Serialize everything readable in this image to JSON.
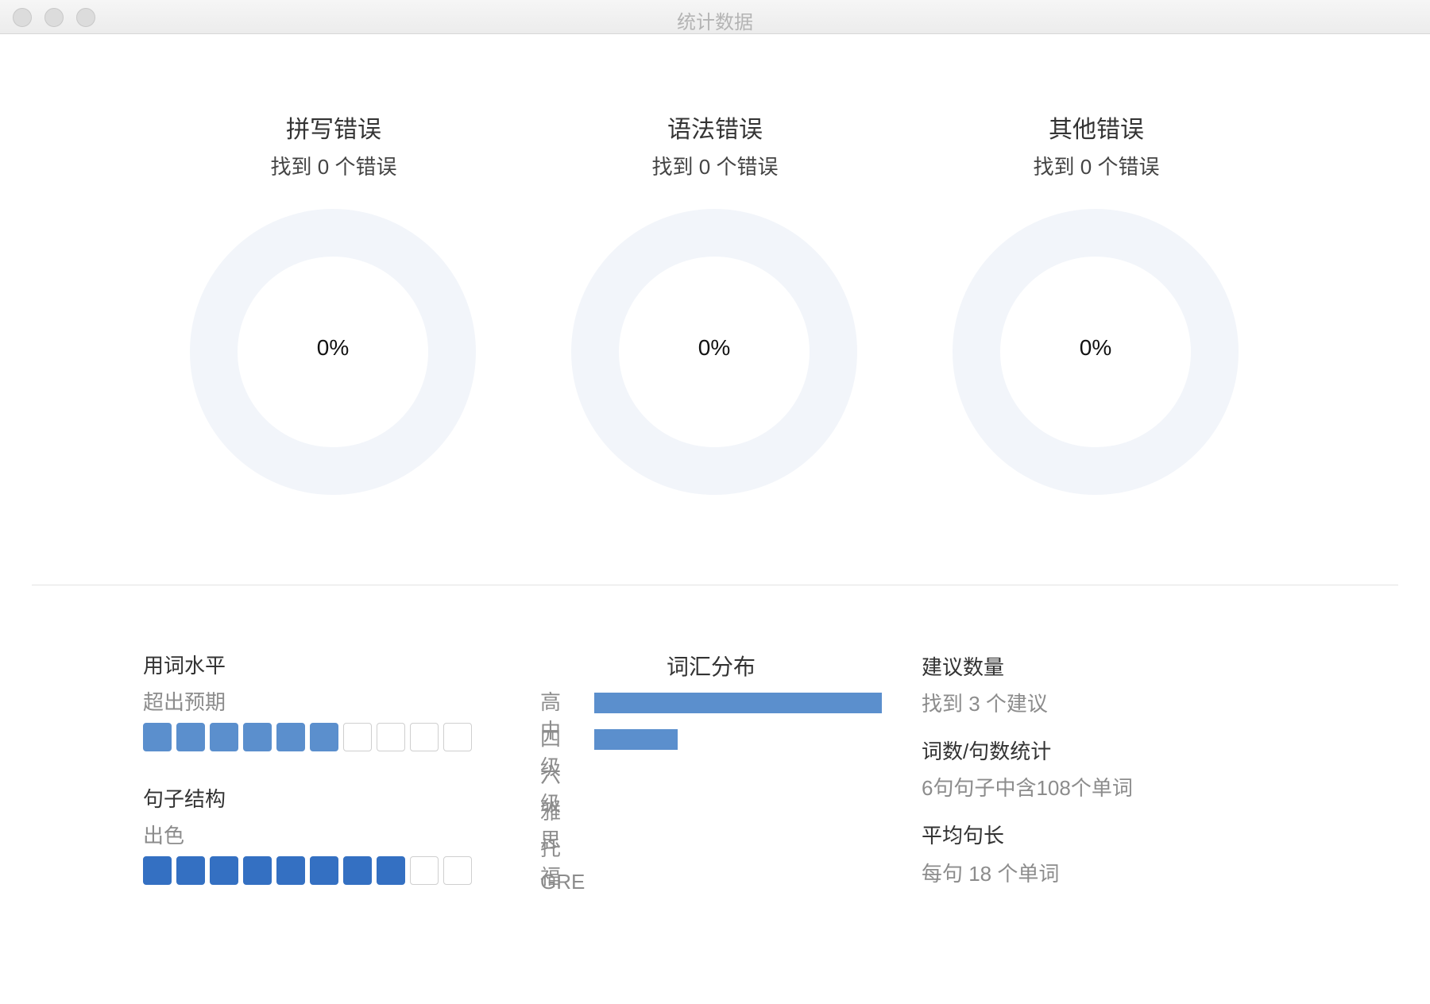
{
  "window": {
    "title": "统计数据"
  },
  "errors": [
    {
      "title": "拼写错误",
      "subtitle": "找到 0 个错误",
      "percent_label": "0%",
      "percent": 0
    },
    {
      "title": "语法错误",
      "subtitle": "找到 0 个错误",
      "percent_label": "0%",
      "percent": 0
    },
    {
      "title": "其他错误",
      "subtitle": "找到 0 个错误",
      "percent_label": "0%",
      "percent": 0
    }
  ],
  "colors": {
    "ring_track": "#f2f5fa",
    "segment_light_blue": "#5b8fcd",
    "segment_dark_blue": "#3470c2",
    "bar_blue": "#5b8fcd"
  },
  "word_level": {
    "title": "用词水平",
    "value": "超出预期",
    "filled": 6,
    "total": 10
  },
  "sentence_structure": {
    "title": "句子结构",
    "value": "出色",
    "filled": 8,
    "total": 10
  },
  "vocab": {
    "title": "词汇分布",
    "rows": [
      {
        "label": "高中",
        "value": 1.0
      },
      {
        "label": "四级",
        "value": 0.29
      },
      {
        "label": "六级",
        "value": 0
      },
      {
        "label": "雅思",
        "value": 0
      },
      {
        "label": "托福",
        "value": 0
      },
      {
        "label": "GRE",
        "value": 0
      }
    ]
  },
  "suggestions": {
    "title": "建议数量",
    "value": "找到 3 个建议"
  },
  "counts": {
    "title": "词数/句数统计",
    "value": "6句句子中含108个单词"
  },
  "avg_length": {
    "title": "平均句长",
    "value": "每句 18 个单词"
  }
}
